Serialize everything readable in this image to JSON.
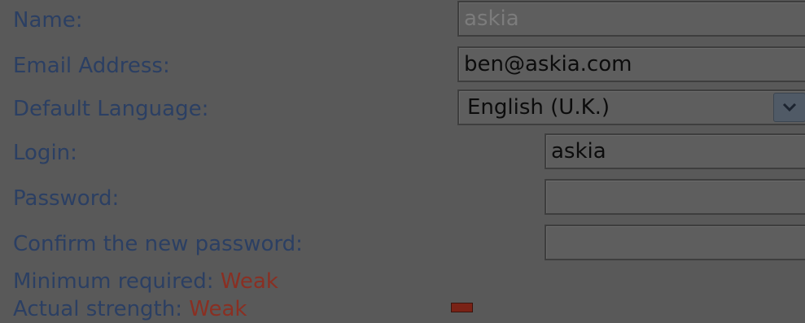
{
  "form": {
    "name": {
      "label": "Name:",
      "value": "askia"
    },
    "email": {
      "label": "Email Address:",
      "value": "ben@askia.com"
    },
    "language": {
      "label": "Default Language:",
      "selected": "English (U.K.)"
    },
    "login": {
      "label": "Login:",
      "value": "askia"
    },
    "password": {
      "label": "Password:",
      "value": ""
    },
    "confirm_password": {
      "label": "Confirm the new password:",
      "value": ""
    },
    "minimum_required": {
      "label": "Minimum required:",
      "value": "Weak"
    },
    "actual_strength": {
      "label": "Actual strength:",
      "value": "Weak"
    }
  },
  "colors": {
    "label_text": "#2b3f63",
    "strength_text": "#8a2f22",
    "strength_meter": "#7a2216",
    "overlay_background": "#595959"
  },
  "icons": {
    "language_dropdown": "chevron-down-icon"
  }
}
